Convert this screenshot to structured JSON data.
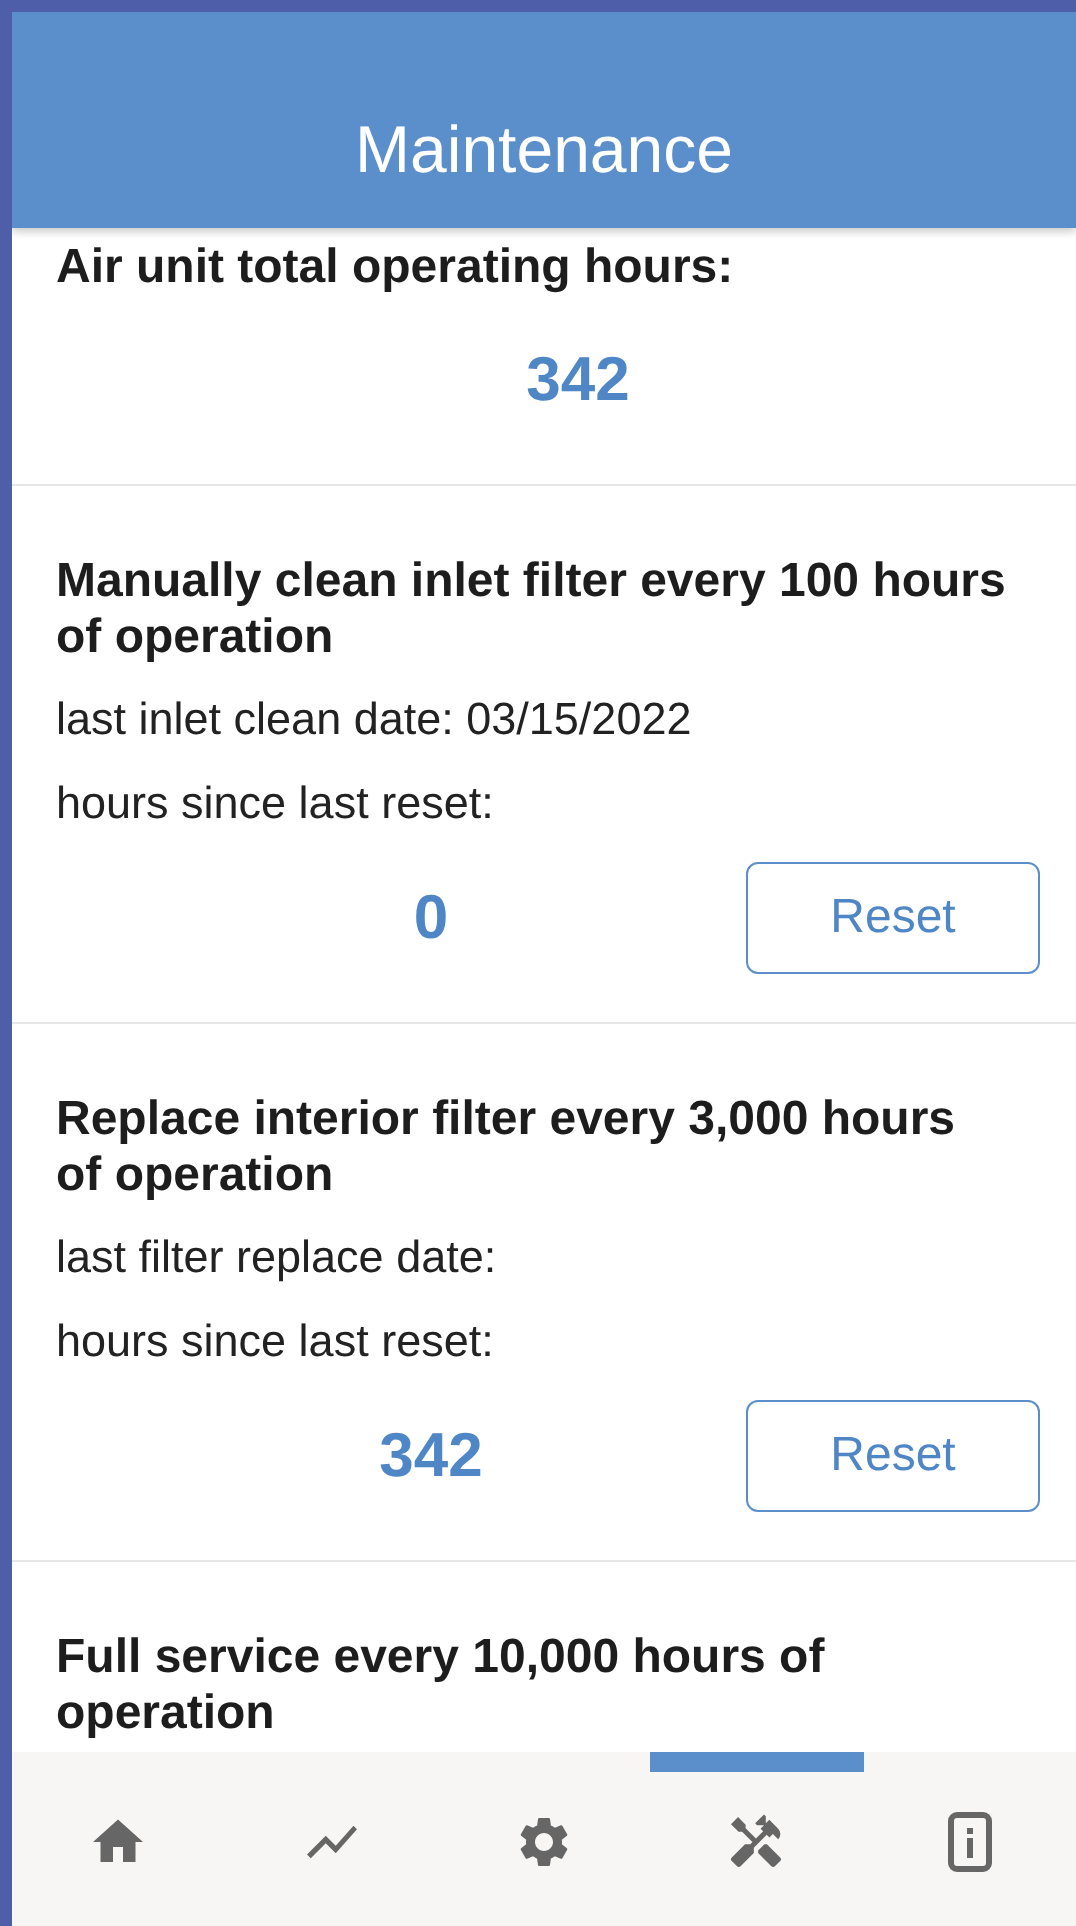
{
  "header": {
    "title": "Maintenance"
  },
  "sections": [
    {
      "title": "Air unit total operating hours:",
      "value": "342"
    },
    {
      "title": "Manually clean inlet filter every 100 hours of operation",
      "lines": [
        "last inlet clean date: 03/15/2022",
        "hours since last reset:"
      ],
      "value": "0",
      "button": "Reset"
    },
    {
      "title": "Replace interior filter every 3,000 hours of operation",
      "lines": [
        "last filter replace date:",
        "hours since last reset:"
      ],
      "value": "342",
      "button": "Reset"
    },
    {
      "title": "Full service every 10,000 hours of operation"
    }
  ],
  "tabs": [
    {
      "kind": "home",
      "selected": false
    },
    {
      "kind": "chart",
      "selected": false
    },
    {
      "kind": "settings",
      "selected": false
    },
    {
      "kind": "tools",
      "selected": true
    },
    {
      "kind": "info",
      "selected": false
    }
  ]
}
